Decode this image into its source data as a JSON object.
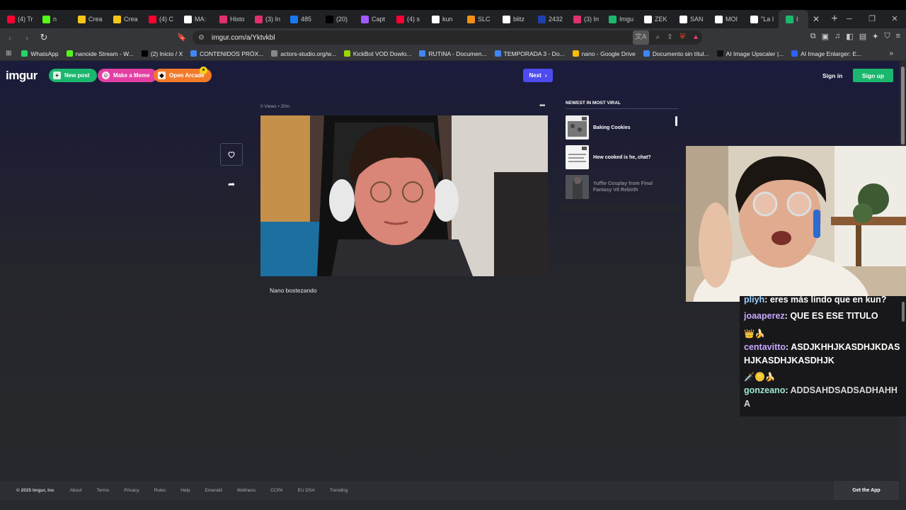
{
  "browser": {
    "tabs": [
      {
        "label": "(4) Tr",
        "color": "#ff0033"
      },
      {
        "label": "n",
        "color": "#53fc18"
      },
      {
        "label": "Crea",
        "color": "#f5c518"
      },
      {
        "label": "Crea",
        "color": "#f5c518"
      },
      {
        "label": "(4) C",
        "color": "#ff0033"
      },
      {
        "label": "MA:",
        "color": "#ffffff"
      },
      {
        "label": "Histo",
        "color": "#e1306c"
      },
      {
        "label": "(3) In",
        "color": "#e1306c"
      },
      {
        "label": "485",
        "color": "#1877f2"
      },
      {
        "label": "(20)",
        "color": "#000000"
      },
      {
        "label": "Capt",
        "color": "#a259ff"
      },
      {
        "label": "(4) s",
        "color": "#ff0033"
      },
      {
        "label": "kun",
        "color": "#ffffff"
      },
      {
        "label": "SLC",
        "color": "#f29111"
      },
      {
        "label": "blitz",
        "color": "#ffffff"
      },
      {
        "label": "2432",
        "color": "#1e40af"
      },
      {
        "label": "(3) In",
        "color": "#e1306c"
      },
      {
        "label": "Imgu",
        "color": "#1bb76e"
      },
      {
        "label": "ZEK",
        "color": "#ffffff"
      },
      {
        "label": "SAN",
        "color": "#ffffff"
      },
      {
        "label": "MOI",
        "color": "#ffffff"
      },
      {
        "label": "\"La I",
        "color": "#ffffff"
      }
    ],
    "active_tab": {
      "label": "I",
      "color": "#1bb76e"
    },
    "url": "imgur.com/a/Yktvkbl",
    "bookmarks": [
      {
        "label": "WhatsApp",
        "color": "#25d366"
      },
      {
        "label": "nanoide Stream - W...",
        "color": "#53fc18"
      },
      {
        "label": "(2) Inicio / X",
        "color": "#000000"
      },
      {
        "label": "CONTENIDOS PRÓX...",
        "color": "#4285f4"
      },
      {
        "label": "actors-studio.org/w...",
        "color": "#888888"
      },
      {
        "label": "KickBot VOD Dowlo...",
        "color": "#9bd800"
      },
      {
        "label": "RUTINA - Documen...",
        "color": "#4285f4"
      },
      {
        "label": "TEMPORADA 3 - Do...",
        "color": "#4285f4"
      },
      {
        "label": "nano - Google Drive",
        "color": "#fbbc04"
      },
      {
        "label": "Documento sin títul...",
        "color": "#4285f4"
      },
      {
        "label": "AI Image Upscaler |...",
        "color": "#111111"
      },
      {
        "label": "AI Image Enlarger: E...",
        "color": "#2962ff"
      }
    ]
  },
  "imgur": {
    "logo": "imgur",
    "new_post": "New post",
    "make_meme": "Make a Meme",
    "open_arcade": "Open Arcade",
    "next": "Next",
    "sign_in": "Sign in",
    "sign_up": "Sign up",
    "views": "0 Views",
    "age": "20m",
    "caption": "Nano bostezando",
    "viral_title": "NEWEST IN MOST VIRAL",
    "viral_items": [
      {
        "title": "Baking Cookies"
      },
      {
        "title": "How cooked is he, chat?"
      },
      {
        "title": "Yuffie Cosplay from Final Fantasy VII Rebirth"
      }
    ],
    "footer": {
      "copyright": "© 2025 Imgur, Inc",
      "links": [
        "About",
        "Terms",
        "Privacy",
        "Rules",
        "Help",
        "Emerald",
        "Wellness",
        "CCPA",
        "EU DSA",
        "Trending"
      ],
      "get_app": "Get the App"
    }
  },
  "chat": {
    "messages": [
      {
        "user": "pliyh",
        "text": "eres más lindo que en kun?",
        "color": "#9cd0ff"
      },
      {
        "user": "joaaperez",
        "text": "QUE ES ESE TITULO",
        "color": "#c7a6ff"
      },
      {
        "user": "centavitto",
        "text": "ASDJKHHJKASDHJKDASHJKASDHJKASDHJK",
        "color": "#c7a6ff",
        "badges": "👑🍌"
      },
      {
        "user": "gonzeano",
        "text": "ADDSAHDSADSADHAHHA",
        "color": "#9fe7cf",
        "badges": "🗡️🪙🍌"
      }
    ]
  }
}
